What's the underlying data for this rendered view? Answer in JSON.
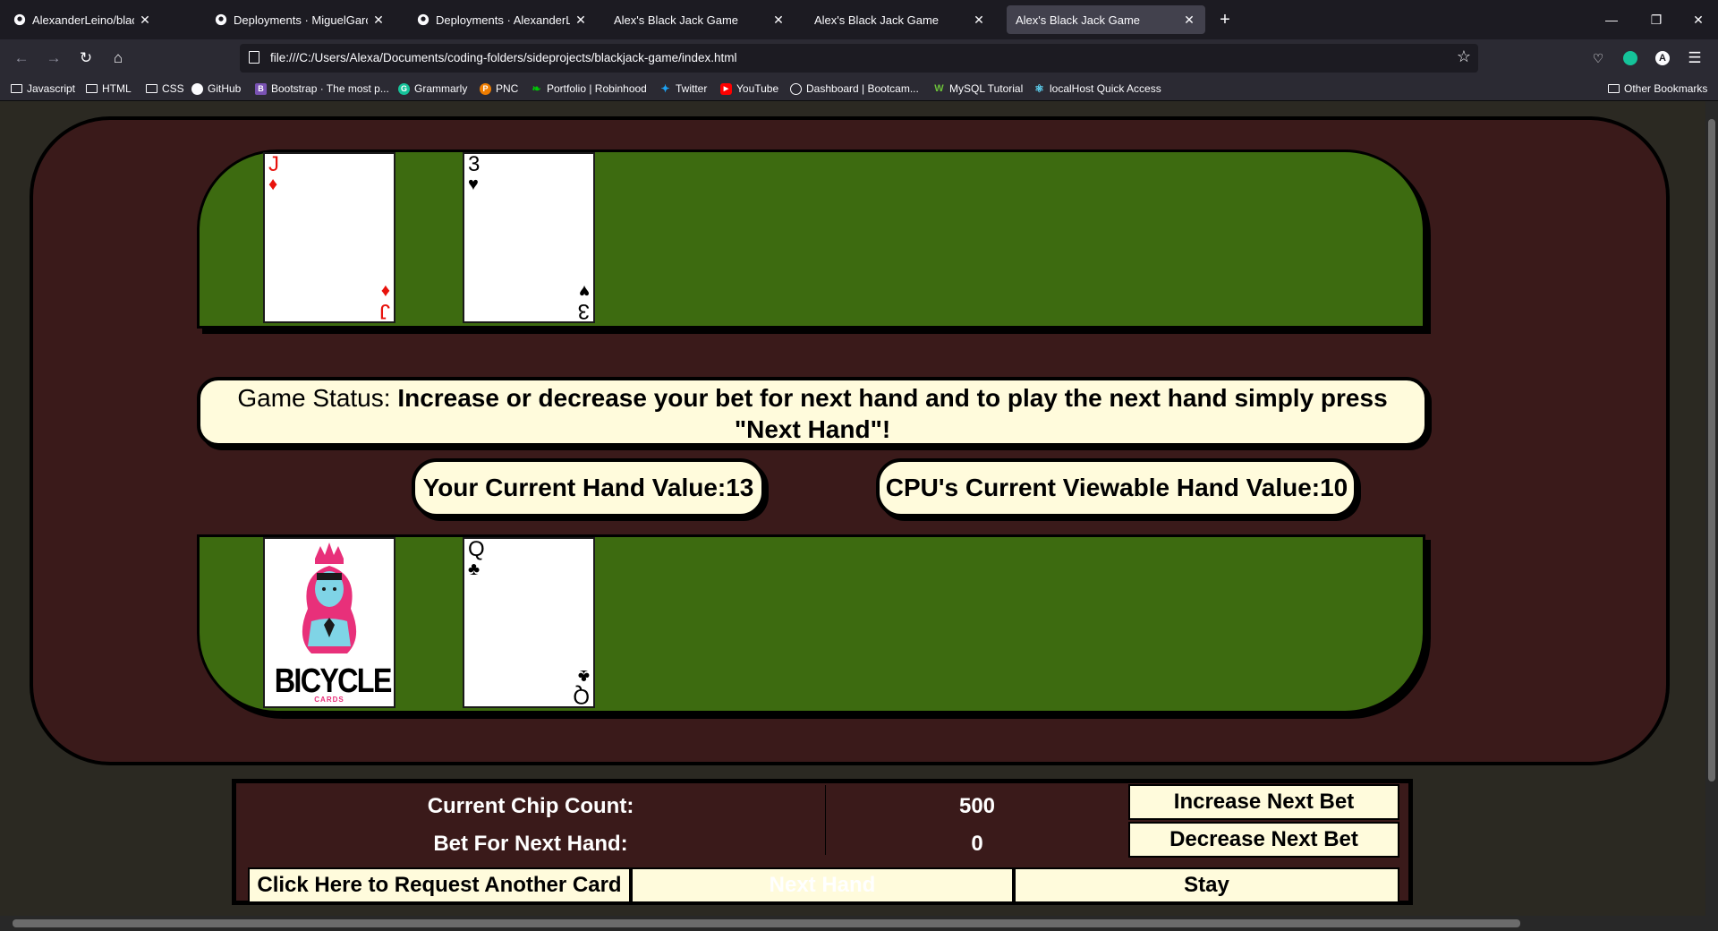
{
  "browser": {
    "tabs": [
      {
        "label": "AlexanderLeino/blackjack-gam",
        "icon": "github-icon",
        "active": false
      },
      {
        "label": "Deployments · MiguelGarciaCa",
        "icon": "github-icon",
        "active": false
      },
      {
        "label": "Deployments · AlexanderLeino/",
        "icon": "github-icon",
        "active": false
      },
      {
        "label": "Alex's Black Jack Game",
        "icon": "",
        "active": false
      },
      {
        "label": "Alex's Black Jack Game",
        "icon": "",
        "active": false
      },
      {
        "label": "Alex's Black Jack Game",
        "icon": "",
        "active": true
      }
    ],
    "url": "file:///C:/Users/Alexa/Documents/coding-folders/sideprojects/blackjack-game/index.html",
    "bookmarks": [
      {
        "label": "Javascript",
        "icon": "folder-icon"
      },
      {
        "label": "HTML",
        "icon": "folder-icon"
      },
      {
        "label": "CSS",
        "icon": "folder-icon"
      },
      {
        "label": "GitHub",
        "icon": "github-icon"
      },
      {
        "label": "Bootstrap · The most p...",
        "icon": "bootstrap-icon"
      },
      {
        "label": "Grammarly",
        "icon": "grammarly-icon"
      },
      {
        "label": "PNC",
        "icon": "pnc-icon"
      },
      {
        "label": "Portfolio | Robinhood",
        "icon": "robinhood-icon"
      },
      {
        "label": "Twitter",
        "icon": "twitter-icon"
      },
      {
        "label": "YouTube",
        "icon": "youtube-icon"
      },
      {
        "label": "Dashboard | Bootcam...",
        "icon": "globe-icon"
      },
      {
        "label": "MySQL Tutorial",
        "icon": "mysql-icon"
      },
      {
        "label": "localHost Quick Access",
        "icon": "react-icon"
      }
    ],
    "other_bookmarks": "Other Bookmarks"
  },
  "game": {
    "dealer_cards": [
      {
        "rank": "J",
        "suit": "♦",
        "color": "red"
      },
      {
        "rank": "3",
        "suit": "♥",
        "color": "black"
      }
    ],
    "player_cards": [
      {
        "face_down": true,
        "back_brand": "BICYCLE",
        "back_sub": "CARDS"
      },
      {
        "rank": "Q",
        "suit": "♣",
        "color": "black"
      }
    ],
    "status_label": "Game Status: ",
    "status_message": "Increase or decrease your bet for next hand and to play the next hand simply press \"Next Hand\"!",
    "your_hand_value": "Your Current Hand Value:13",
    "cpu_hand_value": "CPU's Current Viewable Hand Value:10",
    "chip_count_label": "Current Chip Count:",
    "chip_count": "500",
    "bet_label": "Bet For Next Hand:",
    "bet_value": "0",
    "increase_bet": "Increase Next Bet",
    "decrease_bet": "Decrease Next Bet",
    "hit_button": "Click Here to Request Another Card",
    "next_hand_button": "Next Hand",
    "stay_button": "Stay"
  },
  "colors": {
    "felt": "#3d6b10",
    "table": "#3a1a1a",
    "pill": "#fffbdc",
    "page_bg": "#2b2922"
  }
}
